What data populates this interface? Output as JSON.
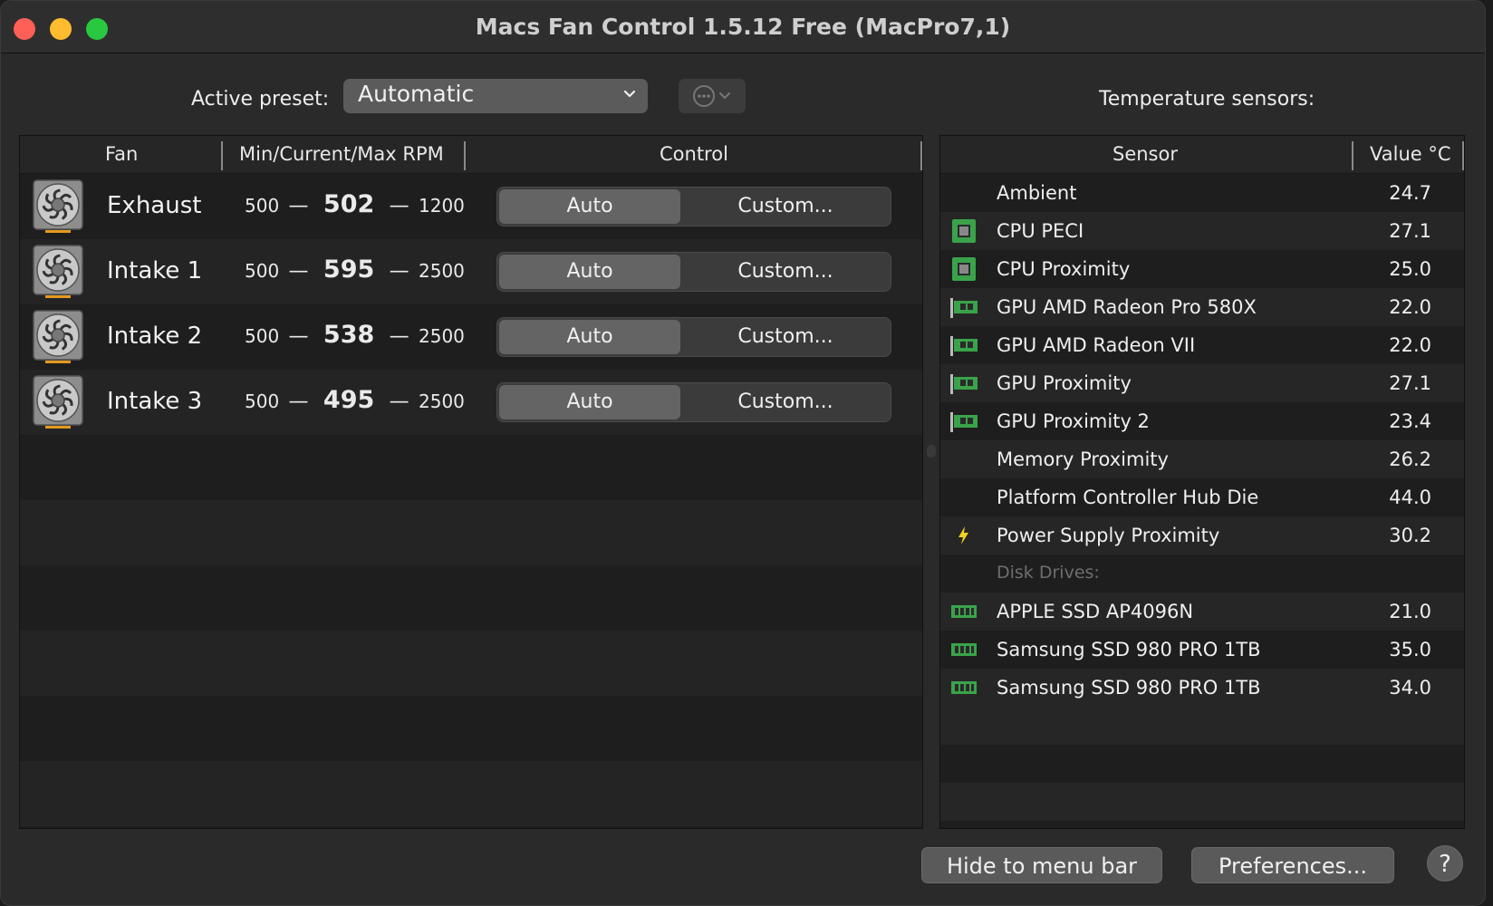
{
  "window": {
    "title": "Macs Fan Control 1.5.12 Free (MacPro7,1)"
  },
  "preset": {
    "label": "Active preset:",
    "value": "Automatic"
  },
  "sensors_title": "Temperature sensors:",
  "fan_table": {
    "headers": [
      "Fan",
      "Min/Current/Max RPM",
      "Control"
    ],
    "control_auto": "Auto",
    "control_custom": "Custom...",
    "dash": "—",
    "rows": [
      {
        "name": "Exhaust",
        "min": "500",
        "current": "502",
        "max": "1200"
      },
      {
        "name": "Intake 1",
        "min": "500",
        "current": "595",
        "max": "2500"
      },
      {
        "name": "Intake 2",
        "min": "500",
        "current": "538",
        "max": "2500"
      },
      {
        "name": "Intake 3",
        "min": "500",
        "current": "495",
        "max": "2500"
      }
    ]
  },
  "sensor_table": {
    "headers": [
      "Sensor",
      "Value °C"
    ],
    "rows": [
      {
        "name": "Ambient",
        "value": "24.7",
        "icon": "none"
      },
      {
        "name": "CPU PECI",
        "value": "27.1",
        "icon": "cpu-chip-icon"
      },
      {
        "name": "CPU Proximity",
        "value": "25.0",
        "icon": "cpu-chip-icon"
      },
      {
        "name": "GPU AMD Radeon Pro 580X",
        "value": "22.0",
        "icon": "gpu-card-icon"
      },
      {
        "name": "GPU AMD Radeon VII",
        "value": "22.0",
        "icon": "gpu-card-icon"
      },
      {
        "name": "GPU Proximity",
        "value": "27.1",
        "icon": "gpu-card-icon"
      },
      {
        "name": "GPU Proximity 2",
        "value": "23.4",
        "icon": "gpu-card-icon"
      },
      {
        "name": "Memory Proximity",
        "value": "26.2",
        "icon": "none"
      },
      {
        "name": "Platform Controller Hub Die",
        "value": "44.0",
        "icon": "none"
      },
      {
        "name": "Power Supply Proximity",
        "value": "30.2",
        "icon": "lightning-icon"
      },
      {
        "group": "Disk Drives:"
      },
      {
        "name": "APPLE SSD AP4096N",
        "value": "21.0",
        "icon": "ssd-icon"
      },
      {
        "name": "Samsung SSD 980 PRO 1TB",
        "value": "35.0",
        "icon": "ssd-icon"
      },
      {
        "name": "Samsung SSD 980 PRO 1TB",
        "value": "34.0",
        "icon": "ssd-icon"
      }
    ]
  },
  "buttons": {
    "hide": "Hide to menu bar",
    "preferences": "Preferences...",
    "help": "?"
  },
  "colors": {
    "close": "#fe5f57",
    "minimize": "#febc2e",
    "maximize": "#28c840",
    "chip_green": "#3aa34a",
    "bolt": "#f2d024",
    "fan_orange": "#e39a1e"
  }
}
